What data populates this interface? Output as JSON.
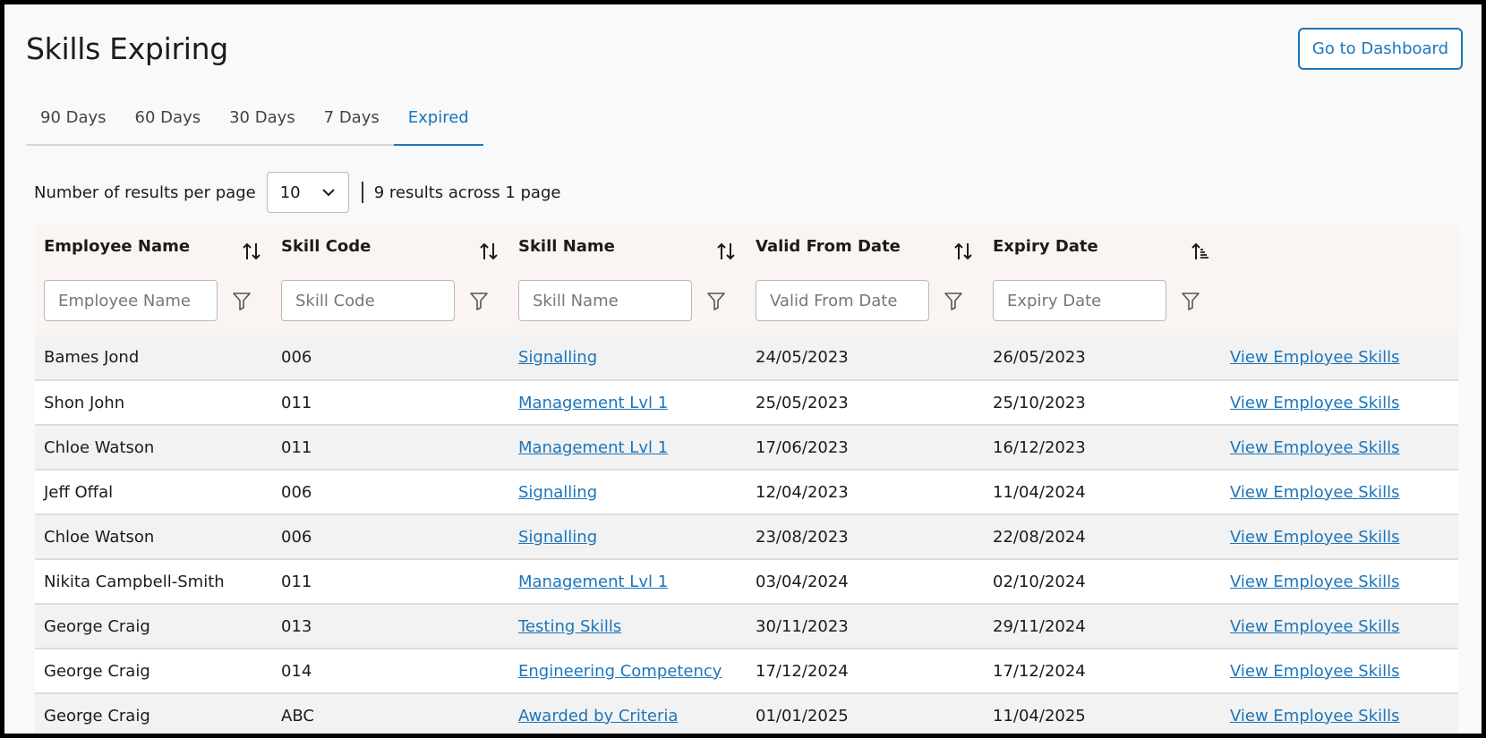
{
  "page": {
    "title": "Skills Expiring",
    "dashboard_button": "Go to Dashboard"
  },
  "tabs": [
    {
      "label": "90 Days",
      "active": false
    },
    {
      "label": "60 Days",
      "active": false
    },
    {
      "label": "30 Days",
      "active": false
    },
    {
      "label": "7 Days",
      "active": false
    },
    {
      "label": "Expired",
      "active": true
    }
  ],
  "pagination": {
    "per_page_label": "Number of results per page",
    "per_page_value": "10",
    "summary": "9 results across 1 page"
  },
  "table": {
    "columns": [
      {
        "label": "Employee Name",
        "filter_placeholder": "Employee Name",
        "sort": "sort-arrows-icon"
      },
      {
        "label": "Skill Code",
        "filter_placeholder": "Skill Code",
        "sort": "sort-arrows-icon"
      },
      {
        "label": "Skill Name",
        "filter_placeholder": "Skill Name",
        "sort": "sort-arrows-icon"
      },
      {
        "label": "Valid From Date",
        "filter_placeholder": "Valid From Date",
        "sort": "sort-arrows-icon"
      },
      {
        "label": "Expiry Date",
        "filter_placeholder": "Expiry Date",
        "sort": "sort-ascending-icon"
      }
    ],
    "action_label": "View Employee Skills",
    "rows": [
      {
        "employee": "Bames Jond",
        "code": "006",
        "skill": "Signalling",
        "valid_from": "24/05/2023",
        "expiry": "26/05/2023"
      },
      {
        "employee": "Shon John",
        "code": "011",
        "skill": "Management Lvl 1",
        "valid_from": "25/05/2023",
        "expiry": "25/10/2023"
      },
      {
        "employee": "Chloe Watson",
        "code": "011",
        "skill": "Management Lvl 1",
        "valid_from": "17/06/2023",
        "expiry": "16/12/2023"
      },
      {
        "employee": "Jeff Offal",
        "code": "006",
        "skill": "Signalling",
        "valid_from": "12/04/2023",
        "expiry": "11/04/2024"
      },
      {
        "employee": "Chloe Watson",
        "code": "006",
        "skill": "Signalling",
        "valid_from": "23/08/2023",
        "expiry": "22/08/2024"
      },
      {
        "employee": "Nikita Campbell-Smith",
        "code": "011",
        "skill": "Management Lvl 1",
        "valid_from": "03/04/2024",
        "expiry": "02/10/2024"
      },
      {
        "employee": "George Craig",
        "code": "013",
        "skill": "Testing Skills",
        "valid_from": "30/11/2023",
        "expiry": "29/11/2024"
      },
      {
        "employee": "George Craig",
        "code": "014",
        "skill": "Engineering Competency",
        "valid_from": "17/12/2024",
        "expiry": "17/12/2024"
      },
      {
        "employee": "George Craig",
        "code": "ABC",
        "skill": "Awarded by Criteria",
        "valid_from": "01/01/2025",
        "expiry": "11/04/2025"
      }
    ]
  },
  "colors": {
    "accent": "#1b75bb",
    "header_bg": "#faf5f2",
    "row_alt": "#f2f2f2"
  }
}
